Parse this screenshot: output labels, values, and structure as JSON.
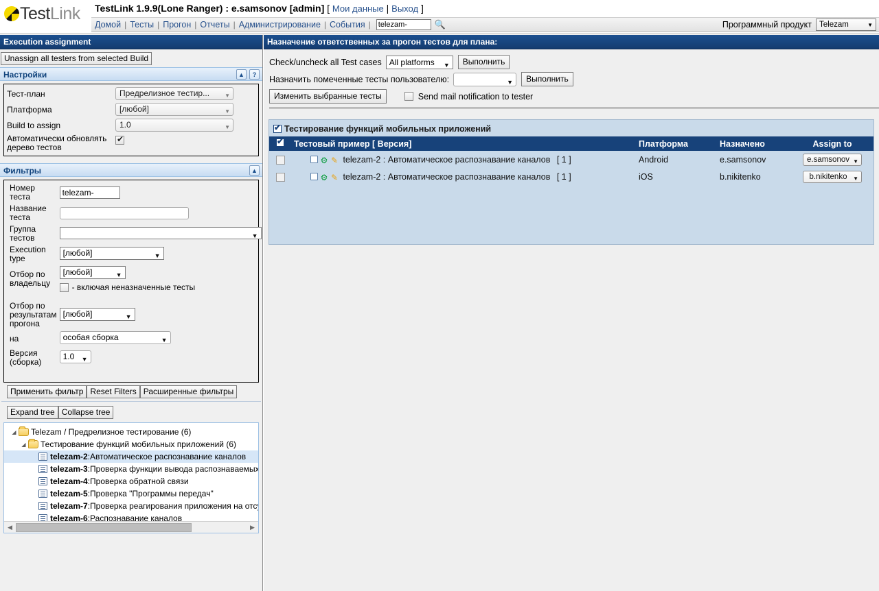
{
  "header": {
    "logo_text_1": "Test",
    "logo_text_2": "Link",
    "title": "TestLink 1.9.9(Lone Ranger) : e.samsonov [admin]",
    "bracket_open": "[",
    "bracket_close": "]",
    "pipe": "|",
    "my_settings_link": "Мои данные",
    "logout_link": "Выход",
    "nav": [
      {
        "label": "Домой"
      },
      {
        "label": "Тесты"
      },
      {
        "label": "Прогон"
      },
      {
        "label": "Отчеты"
      },
      {
        "label": "Администрирование"
      },
      {
        "label": "События"
      }
    ],
    "nav_separator": "|",
    "search_value": "telezam-",
    "search_icon": "search-icon",
    "product_label": "Программный продукт",
    "product_value": "Telezam"
  },
  "left_panel": {
    "title": "Execution assignment",
    "unassign_button": "Unassign all testers from selected Build",
    "settings": {
      "section_title": "Настройки",
      "collapse_icon": "▲",
      "help_icon": "?",
      "rows": [
        {
          "label": "Тест-план",
          "value": "Предрелизное тестир..."
        },
        {
          "label": "Платформа",
          "value": "[любой]"
        },
        {
          "label": "Build to assign",
          "value": "1.0"
        }
      ],
      "auto_refresh_label": "Автоматически обновлять дерево тестов",
      "auto_refresh_checked": true
    },
    "filters": {
      "section_title": "Фильтры",
      "collapse_icon": "▲",
      "test_number_label": "Номер теста",
      "test_number_value": "telezam-",
      "test_name_label": "Название теста",
      "test_name_value": "",
      "test_group_label": "Группа тестов",
      "test_group_value": "",
      "execution_type_label": "Execution type",
      "execution_type_value": "[любой]",
      "owner_label": "Отбор по владельцу",
      "owner_value": "[любой]",
      "unassigned_label": "- включая неназначенные тесты",
      "unassigned_checked": false,
      "result_label": "Отбор по результатам прогона",
      "result_value": "[любой]",
      "on_label": "на",
      "on_value": "особая сборка",
      "version_label": "Версия (сборка)",
      "version_value": "1.0",
      "apply_button": "Применить фильтр",
      "reset_button": "Reset Filters",
      "advanced_button": "Расширенные фильтры"
    },
    "tree": {
      "expand_button": "Expand tree",
      "collapse_button": "Collapse tree",
      "nodes": [
        {
          "type": "folder",
          "depth": 0,
          "label": "Telezam / Предрелизное тестирование (6)",
          "expanded": true
        },
        {
          "type": "folder",
          "depth": 1,
          "label": "Тестирование функций мобильных приложений (6)",
          "expanded": true
        },
        {
          "type": "testcase",
          "depth": 2,
          "id": "telezam-2",
          "name": "Автоматическое распознавание каналов",
          "selected": true
        },
        {
          "type": "testcase",
          "depth": 2,
          "id": "telezam-3",
          "name": "Проверка функции вывода распознаваемых кана",
          "selected": false
        },
        {
          "type": "testcase",
          "depth": 2,
          "id": "telezam-4",
          "name": "Проверка обратной связи",
          "selected": false
        },
        {
          "type": "testcase",
          "depth": 2,
          "id": "telezam-5",
          "name": "Проверка \"Программы передач\"",
          "selected": false
        },
        {
          "type": "testcase",
          "depth": 2,
          "id": "telezam-7",
          "name": "Проверка реагирования приложения на отсутств",
          "selected": false
        },
        {
          "type": "testcase",
          "depth": 2,
          "id": "telezam-6",
          "name": "Распознавание каналов",
          "selected": false
        }
      ],
      "scroll_left_icon": "◀",
      "scroll_right_icon": "▶"
    }
  },
  "right_panel": {
    "title": "Назначение ответственных за прогон тестов для плана:",
    "check_all_label": "Check/uncheck all Test cases",
    "platform_value": "All platforms",
    "do_button_1": "Выполнить",
    "assign_user_label": "Назначить помеченные тесты пользователю:",
    "assign_user_value": "",
    "do_button_2": "Выполнить",
    "change_selected_button": "Изменить выбранные тесты",
    "send_mail_label": "Send mail notification to tester",
    "send_mail_checked": false,
    "suite_name": "Тестирование функций мобильных приложений",
    "suite_checked": true,
    "table": {
      "headers": [
        "Тестовый пример [ Версия]",
        "Платформа",
        "Назначено",
        "Assign to"
      ],
      "header_checkbox_checked": true,
      "rows": [
        {
          "checked": false,
          "icons": [
            "doc-icon",
            "gear-icon",
            "pencil-icon"
          ],
          "testcase": "telezam-2 : Автоматическое распознавание каналов",
          "version": "[ 1 ]",
          "platform": "Android",
          "assigned": "e.samsonov",
          "assign_to": "e.samsonov"
        },
        {
          "checked": false,
          "icons": [
            "doc-icon",
            "gear-icon",
            "pencil-icon"
          ],
          "testcase": "telezam-2 : Автоматическое распознавание каналов",
          "version": "[ 1 ]",
          "platform": "iOS",
          "assigned": "b.nikitenko",
          "assign_to": "b.nikitenko"
        }
      ]
    }
  },
  "colors": {
    "panel_header": "#17427a",
    "content_bg": "#c9daea",
    "link": "#26508c",
    "accent_yellow": "#f5d900"
  }
}
